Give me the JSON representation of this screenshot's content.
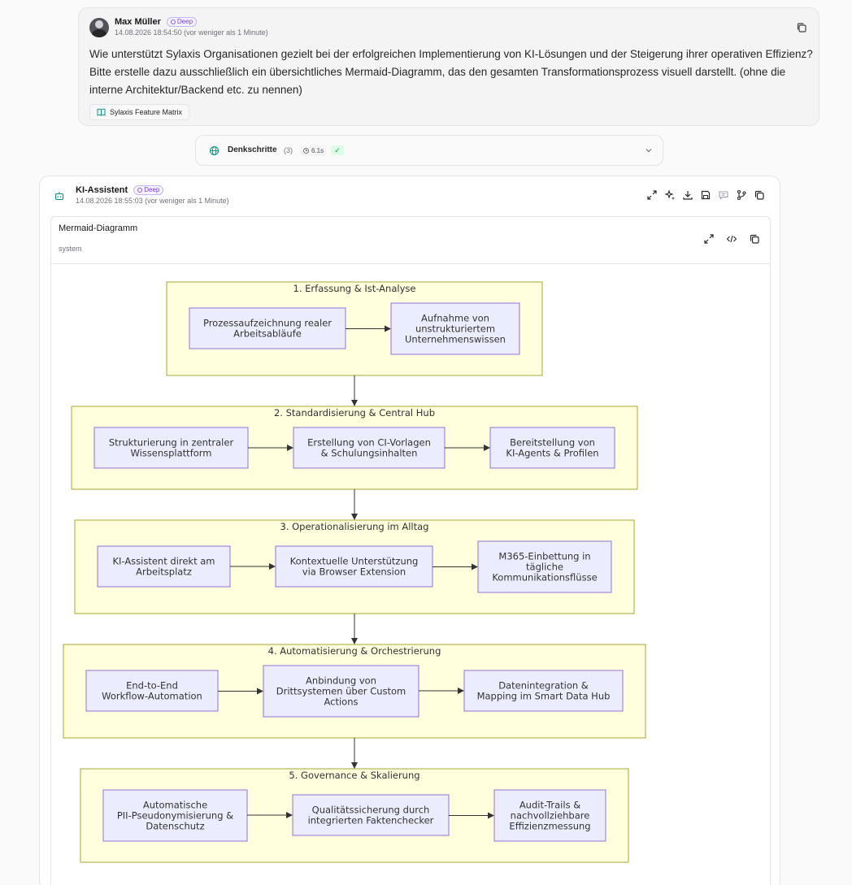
{
  "user_message": {
    "name": "Max Müller",
    "badge": "Deep",
    "timestamp": "14.08.2026 18:54:50 (vor weniger als 1 Minute)",
    "text": "Wie unterstützt Sylaxis Organisationen gezielt bei der erfolgreichen Implementierung von KI-Lösungen und der Steigerung ihrer operativen Effizienz? Bitte erstelle dazu ausschließlich ein übersichtliches Mermaid-Diagramm, das den gesamten Transformationsprozess visuell darstellt. (ohne die interne Architektur/Backend etc. zu nennen)",
    "attachment": "Sylaxis Feature Matrix"
  },
  "thinking": {
    "label": "Denkschritte",
    "count": "(3)",
    "duration": "6.1s"
  },
  "assistant": {
    "name": "KI-Assistent",
    "badge": "Deep",
    "timestamp": "14.08.2026 18:55:03 (vor weniger als 1 Minute)"
  },
  "diagram_panel": {
    "title": "Mermaid-Diagramm",
    "subtitle": "system"
  },
  "diagram": {
    "phases": [
      {
        "title": "1. Erfassung & Ist-Analyse",
        "nodes": [
          [
            "Prozessaufzeichnung realer",
            "Arbeitsabläufe"
          ],
          [
            "Aufnahme von",
            "unstrukturiertem",
            "Unternehmenswissen"
          ]
        ]
      },
      {
        "title": "2. Standardisierung & Central Hub",
        "nodes": [
          [
            "Strukturierung in zentraler",
            "Wissensplattform"
          ],
          [
            "Erstellung von CI-Vorlagen",
            "& Schulungsinhalten"
          ],
          [
            "Bereitstellung von",
            "KI-Agents & Profilen"
          ]
        ]
      },
      {
        "title": "3. Operationalisierung im Alltag",
        "nodes": [
          [
            "KI-Assistent direkt am",
            "Arbeitsplatz"
          ],
          [
            "Kontextuelle Unterstützung",
            "via Browser Extension"
          ],
          [
            "M365-Einbettung in",
            "tägliche",
            "Kommunikationsflüsse"
          ]
        ]
      },
      {
        "title": "4. Automatisierung & Orchestrierung",
        "nodes": [
          [
            "End-to-End",
            "Workflow-Automation"
          ],
          [
            "Anbindung von",
            "Drittsystemen über Custom",
            "Actions"
          ],
          [
            "Datenintegration &",
            "Mapping im Smart Data Hub"
          ]
        ]
      },
      {
        "title": "5. Governance & Skalierung",
        "nodes": [
          [
            "Automatische",
            "PII-Pseudonymisierung &",
            "Datenschutz"
          ],
          [
            "Qualitätssicherung durch",
            "integrierten Faktenchecker"
          ],
          [
            "Audit-Trails &",
            "nachvollziehbare",
            "Effizienzmessung"
          ]
        ]
      }
    ]
  },
  "colors": {
    "cluster_fill": "#ffffde",
    "cluster_stroke": "#aaaa33",
    "node_fill": "#ececff",
    "node_stroke": "#9370db",
    "badge_purple": "#7c3aed"
  }
}
